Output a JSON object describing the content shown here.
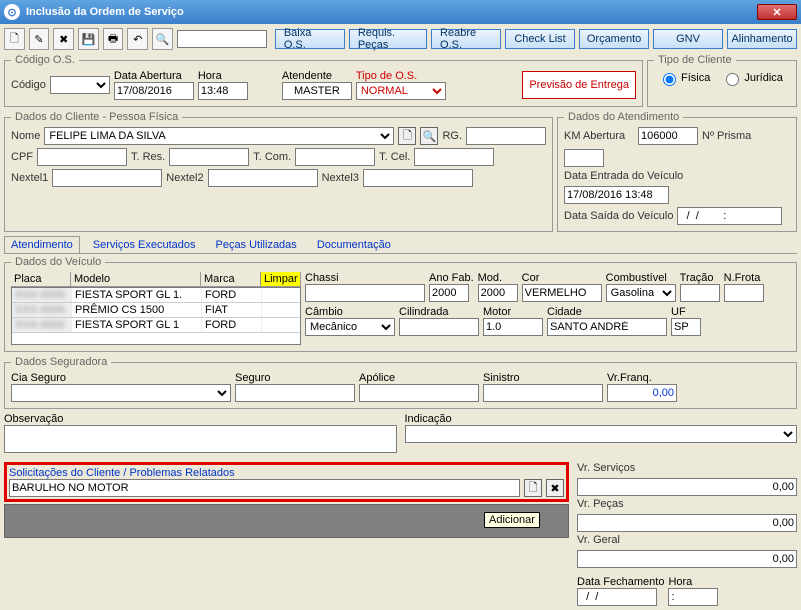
{
  "window": {
    "title": "Inclusão da Ordem de Serviço"
  },
  "toolbar_buttons": {
    "baixa": "Baixa O.S.",
    "requis": "Requis. Peças",
    "reabre": "Reabre O.S.",
    "checklist": "Check List",
    "orcamento": "Orçamento",
    "gnv": "GNV",
    "alinhamento": "Alinhamento"
  },
  "codigo_os": {
    "legend": "Código O.S.",
    "codigo_label": "Código",
    "data_abertura_label": "Data Abertura",
    "data_abertura": "17/08/2016",
    "hora_label": "Hora",
    "hora": "13:48",
    "atendente_label": "Atendente",
    "atendente": "MASTER",
    "tipo_os_label": "Tipo de O.S.",
    "tipo_os": "NORMAL",
    "previsao_btn": "Previsão de Entrega",
    "tipo_cliente_label": "Tipo de Cliente",
    "fisica": "Física",
    "juridica": "Jurídica"
  },
  "dados_cliente": {
    "legend": "Dados do Cliente - Pessoa Física",
    "nome_label": "Nome",
    "nome": "FELIPE LIMA DA SILVA",
    "rg_label": "RG.",
    "cpf_label": "CPF",
    "tres_label": "T. Res.",
    "tcom_label": "T. Com.",
    "tcel_label": "T. Cel.",
    "nextel1_label": "Nextel1",
    "nextel2_label": "Nextel2",
    "nextel3_label": "Nextel3"
  },
  "dados_atendimento": {
    "legend": "Dados do Atendimento",
    "km_label": "KM Abertura",
    "km": "106000",
    "prisma_label": "Nº Prisma",
    "entrada_label": "Data Entrada do Veículo",
    "entrada": "17/08/2016 13:48",
    "saida_label": "Data Saída do Veículo",
    "saida": "  /  /        :"
  },
  "tabs": {
    "atendimento": "Atendimento",
    "servicos": "Serviços Executados",
    "pecas": "Peças Utilizadas",
    "docs": "Documentação"
  },
  "dados_veiculo": {
    "legend": "Dados do Veículo",
    "limpar": "Limpar",
    "headers": {
      "placa": "Placa",
      "modelo": "Modelo",
      "marca": "Marca",
      "chassi": "Chassi",
      "anofab": "Ano Fab.",
      "mod": "Mod.",
      "cor": "Cor",
      "combustivel": "Combustível",
      "tracao": "Tração",
      "nfrota": "N.Frota",
      "cambio": "Câmbio",
      "cilindrada": "Cilindrada",
      "motor": "Motor",
      "cidade": "Cidade",
      "uf": "UF"
    },
    "row1": {
      "modelo": "FIESTA SPORT GL 1.",
      "marca": "FORD",
      "anofab": "2000",
      "mod": "2000",
      "cor": "VERMELHO",
      "combustivel": "Gasolina"
    },
    "row2": {
      "modelo": "PRÊMIO CS 1500",
      "marca": "FIAT"
    },
    "row3": {
      "modelo": "FIESTA SPORT GL 1",
      "marca": "FORD"
    },
    "detail": {
      "cambio": "Mecânico",
      "motor": "1.0",
      "cidade": "SANTO ANDRÉ",
      "uf": "SP"
    }
  },
  "seguradora": {
    "legend": "Dados Seguradora",
    "cia": "Cia Seguro",
    "seguro": "Seguro",
    "apolice": "Apólice",
    "sinistro": "Sinistro",
    "vrfranq": "Vr.Franq.",
    "vrfranq_val": "0,00"
  },
  "obs_label": "Observação",
  "indicacao_label": "Indicação",
  "solicitacoes": {
    "legend": "Solicitações do Cliente / Problemas Relatados",
    "value": "BARULHO NO MOTOR",
    "tooltip": "Adicionar"
  },
  "totals": {
    "vr_servicos_label": "Vr. Serviços",
    "vr_servicos": "0,00",
    "vr_pecas_label": "Vr. Peças",
    "vr_pecas": "0,00",
    "vr_geral_label": "Vr. Geral",
    "vr_geral": "0,00",
    "data_fech_label": "Data Fechamento",
    "data_fech": "  /  /",
    "hora_label": "Hora",
    "hora": ":"
  }
}
